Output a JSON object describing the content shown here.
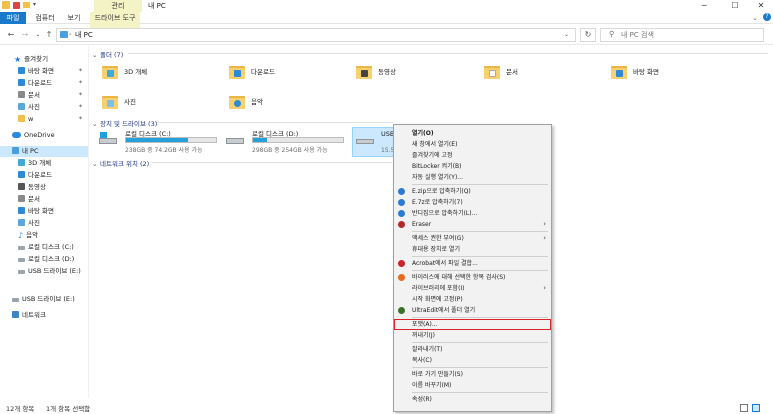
{
  "window": {
    "title": "내 PC",
    "manage_tab": "관리",
    "controls": {
      "minimize": "─",
      "maximize": "☐",
      "close": "✕"
    }
  },
  "ribbon": {
    "tabs": [
      "파일",
      "컴퓨터",
      "보기",
      "드라이브 도구"
    ]
  },
  "address": {
    "path": "내 PC",
    "separator": "›",
    "search_placeholder": "내 PC 검색"
  },
  "sidebar": {
    "quick_access": "즐겨찾기",
    "quick_items": [
      "바탕 화면",
      "다운로드",
      "문서",
      "사진",
      "w"
    ],
    "onedrive": "OneDrive",
    "this_pc": "내 PC",
    "pc_items": [
      "3D 개체",
      "다운로드",
      "동영상",
      "문서",
      "바탕 화면",
      "사진",
      "음악",
      "로컬 디스크 (C:)",
      "로컬 디스크 (D:)",
      "USB 드라이브 (E:)"
    ],
    "usb": "USB 드라이브 (E:)",
    "network": "네트워크"
  },
  "content": {
    "folders_header": "폴더 (7)",
    "folders": [
      "3D 개체",
      "다운로드",
      "동영상",
      "문서",
      "바탕 화면",
      "사진",
      "음악"
    ],
    "drives_header": "장치 및 드라이브 (3)",
    "drives": [
      {
        "name": "로컬 디스크 (C:)",
        "size": "238GB 중 74.2GB 사용 가능",
        "used_fraction": 0.69
      },
      {
        "name": "로컬 디스크 (D:)",
        "size": "298GB 중 254GB 사용 가능",
        "used_fraction": 0.15
      },
      {
        "name": "USB 드",
        "size": "15.5G"
      }
    ],
    "network_header": "네트워크 위치 (2)"
  },
  "status": {
    "count": "12개 항목",
    "selected": "1개 항목 선택함"
  },
  "context_menu": {
    "items": [
      {
        "label": "열기(O)",
        "bold": true
      },
      {
        "label": "새 창에서 열기(E)"
      },
      {
        "label": "즐겨찾기에 고정"
      },
      {
        "label": "BitLocker 켜기(B)"
      },
      {
        "label": "자동 실행 열기(Y)..."
      },
      {
        "label": "E.zip으로 압축하기(Q)",
        "icon": "#2b7bd4"
      },
      {
        "label": "E.7z로 압축하기(7)",
        "icon": "#2b7bd4"
      },
      {
        "label": "반디집으로 압축하기(L)...",
        "icon": "#2b7bd4"
      },
      {
        "label": "Eraser",
        "icon": "#b02a2a",
        "sub": true
      },
      {
        "label": "액세스 권한 부여(G)",
        "sub": true
      },
      {
        "label": "휴대용 장치로 열기"
      },
      {
        "label": "Acrobat에서 파일 결합...",
        "icon": "#c8222a"
      },
      {
        "label": "바이러스에 대해 선택한 항목 검사(S)",
        "icon": "#e86a1d"
      },
      {
        "label": "라이브러리에 포함(I)",
        "sub": true
      },
      {
        "label": "시작 화면에 고정(P)"
      },
      {
        "label": "UltraEdit에서 폴더 열기",
        "icon": "#3b6f2b"
      },
      {
        "label": "포맷(A)...",
        "highlight": true
      },
      {
        "label": "꺼내기(J)"
      },
      {
        "label": "잘라내기(T)"
      },
      {
        "label": "복사(C)"
      },
      {
        "label": "바로 가기 만들기(S)"
      },
      {
        "label": "이름 바꾸기(M)"
      },
      {
        "label": "속성(R)"
      }
    ]
  }
}
